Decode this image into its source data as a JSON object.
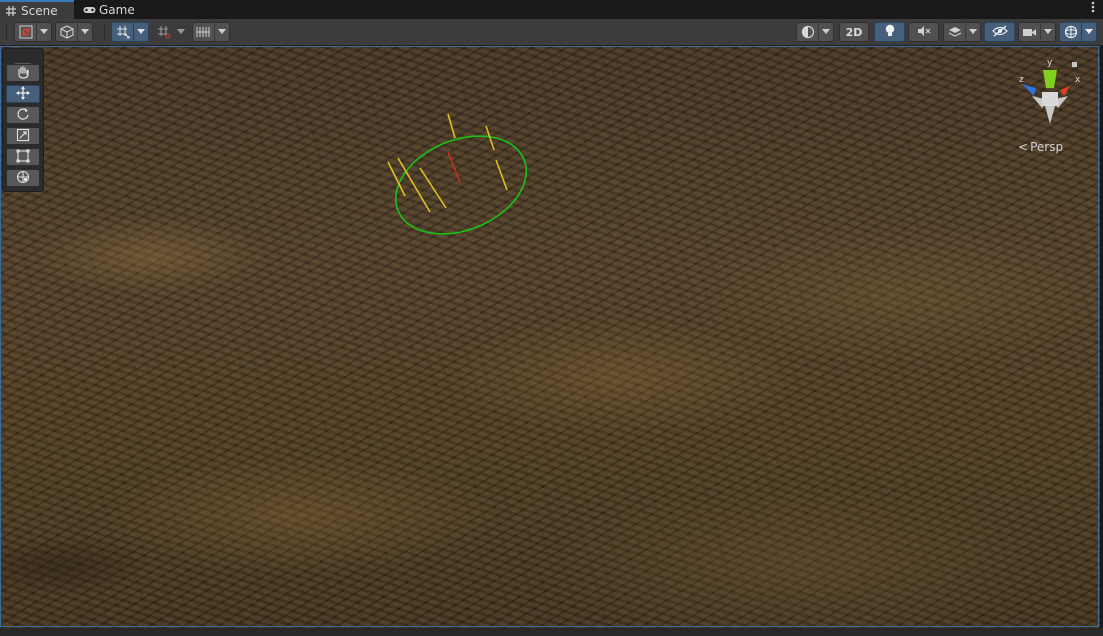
{
  "tabs": [
    {
      "label": "Scene",
      "icon": "hash-grid-icon",
      "active": true
    },
    {
      "label": "Game",
      "icon": "gamepad-icon",
      "active": false
    }
  ],
  "menu": {
    "icon": "kebab-menu-icon"
  },
  "toolbar": {
    "draw_mode_icon": "draw-mode-icon",
    "scene_view_icon": "cube-icon",
    "grid_snap_icon": "grid-snap-icon",
    "increment_snap_icon": "increment-snap-icon",
    "grid_visibility_icon": "grid-visibility-icon",
    "shading_icon": "shading-sphere-icon",
    "mode_2d_label": "2D",
    "lighting_icon": "lightbulb-icon",
    "audio_icon": "audio-muted-icon",
    "effects_icon": "effects-layers-icon",
    "visibility_icon": "hidden-eye-icon",
    "camera_icon": "camera-icon",
    "gizmos_icon": "gizmos-sphere-icon"
  },
  "tools": [
    {
      "name": "hand-tool",
      "icon": "hand-icon",
      "active": false
    },
    {
      "name": "move-tool",
      "icon": "move-arrows-icon",
      "active": true
    },
    {
      "name": "rotate-tool",
      "icon": "rotate-icon",
      "active": false
    },
    {
      "name": "scale-tool",
      "icon": "scale-icon",
      "active": false
    },
    {
      "name": "rect-tool",
      "icon": "rect-transform-icon",
      "active": false
    },
    {
      "name": "transform-tool",
      "icon": "transform-all-icon",
      "active": false
    }
  ],
  "orientation_gizmo": {
    "axes": [
      "y",
      "z",
      "x"
    ],
    "projection_label": "Persp"
  },
  "colors": {
    "accent_blue": "#3a79bb",
    "tab_bg": "#191919",
    "toolbar_bg": "#3c3c3c",
    "selection_circle": "#18c018",
    "gizmo_ray": "#e0c020",
    "gizmo_red": "#c83020",
    "gizmo_x": "#e04020",
    "gizmo_y": "#80d020",
    "gizmo_z": "#3070e0"
  }
}
